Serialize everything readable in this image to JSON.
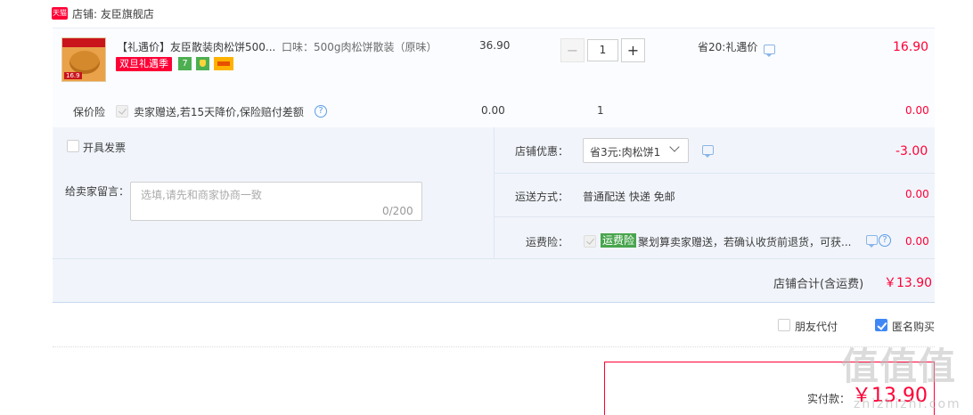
{
  "shop": {
    "badge": "天猫",
    "label": "店铺: 友臣旗舰店"
  },
  "item": {
    "thumb_price": "16.9",
    "title": "【礼遇价】友臣散装肉松饼500...",
    "sku": "口味：500g肉松饼散装（原味）",
    "promo_badge": "双旦礼遇季",
    "icon_7": "7",
    "unit_price": "36.90",
    "quantity": "1",
    "qty_minus": "−",
    "qty_plus": "+",
    "saving": "省20:礼遇价",
    "subtotal": "16.90"
  },
  "insurance": {
    "label": "保价险",
    "description": "卖家赠送,若15天降价,保险赔付差额",
    "help": "?",
    "price": "0.00",
    "quantity": "1",
    "total": "0.00"
  },
  "invoice": {
    "label": "开具发票"
  },
  "message": {
    "label": "给卖家留言：",
    "placeholder": "选填,请先和商家协商一致",
    "count": "0/200"
  },
  "shop_discount": {
    "label": "店铺优惠：",
    "selected": "省3元:肉松饼1",
    "amount": "-3.00"
  },
  "shipping": {
    "label": "运送方式：",
    "value": "普通配送 快递 免邮",
    "amount": "0.00"
  },
  "freight_insurance": {
    "label": "运费险：",
    "badge": "运费险",
    "description": "聚划算卖家赠送，若确认收货前退货，可获...",
    "help": "?",
    "amount": "0.00"
  },
  "shop_total": {
    "label": "店铺合计(含运费)",
    "amount": "￥13.90"
  },
  "options": {
    "friend_pay": "朋友代付",
    "anonymous": "匿名购买",
    "anonymous_checked": true
  },
  "payment": {
    "label": "实付款：",
    "amount": "￥13.90"
  },
  "watermark": {
    "text": "值值值",
    "sub": "zhizhizhi.com"
  },
  "colors": {
    "price_red": "#ff0036",
    "link_blue": "#3f87f5",
    "panel_bg": "#f1f5fb"
  }
}
